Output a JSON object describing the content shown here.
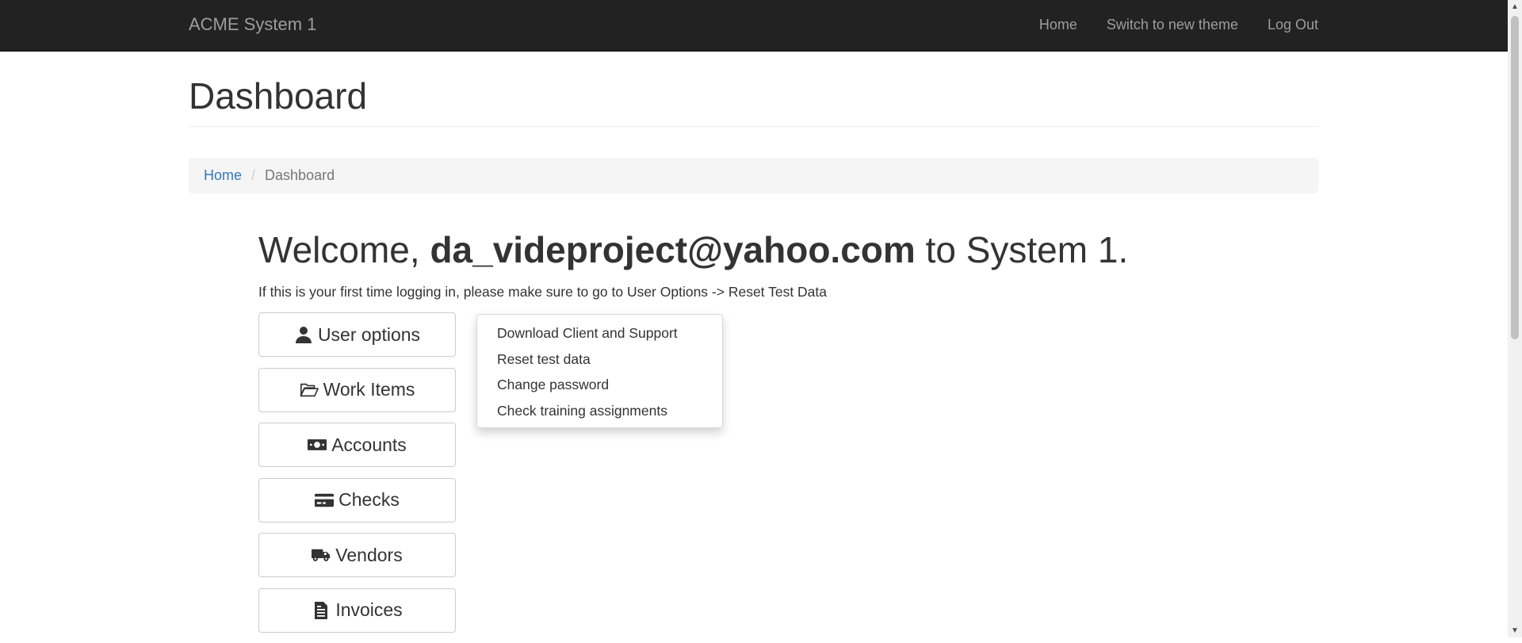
{
  "navbar": {
    "brand": "ACME System 1",
    "links": [
      "Home",
      "Switch to new theme",
      "Log Out"
    ]
  },
  "page": {
    "title": "Dashboard"
  },
  "breadcrumb": {
    "home": "Home",
    "current": "Dashboard"
  },
  "welcome": {
    "prefix": "Welcome, ",
    "email": "da_videproject@yahoo.com",
    "suffix": " to System 1.",
    "note": "If this is your first time logging in, please make sure to go to User Options -> Reset Test Data"
  },
  "buttons": [
    {
      "label": "User options",
      "icon": "user-icon"
    },
    {
      "label": "Work Items",
      "icon": "folder-open-icon"
    },
    {
      "label": "Accounts",
      "icon": "money-bill-icon"
    },
    {
      "label": "Checks",
      "icon": "credit-card-icon"
    },
    {
      "label": "Vendors",
      "icon": "truck-icon"
    },
    {
      "label": "Invoices",
      "icon": "file-text-icon"
    }
  ],
  "dropdown": {
    "items": [
      "Download Client and Support",
      "Reset test data",
      "Change password",
      "Check training assignments"
    ]
  }
}
